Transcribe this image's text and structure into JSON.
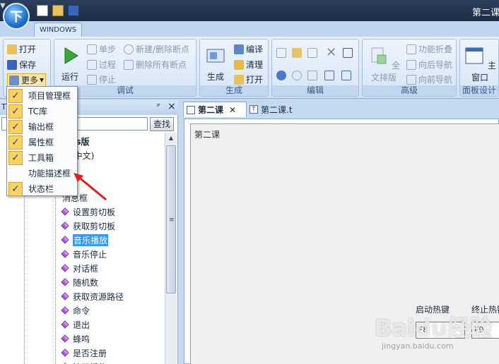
{
  "titlebar": {
    "app_logo": "下",
    "title": "第二课"
  },
  "ribbon": {
    "tab": "WINDOWS",
    "file": {
      "open": "打开",
      "save": "保存",
      "more": "更多"
    },
    "debug": {
      "label": "调试",
      "run": "运行",
      "step": "单步",
      "over": "过程",
      "stop": "停止",
      "new_bp": "新建/删除断点",
      "del_all_bp": "删除所有断点"
    },
    "build": {
      "label": "生成",
      "build": "生成",
      "compile": "编译",
      "clean": "清理",
      "open": "打开"
    },
    "edit": {
      "label": "编辑"
    },
    "advanced": {
      "label": "高级",
      "format": "全文排版",
      "fold": "功能折叠",
      "back": "向后导航",
      "forward": "向前导航"
    },
    "panel": {
      "label": "面板设计",
      "main_window": "主窗口"
    }
  },
  "dropdown": {
    "items": [
      {
        "label": "项目管理框",
        "checked": true
      },
      {
        "label": "TC库",
        "checked": true
      },
      {
        "label": "输出框",
        "checked": true
      },
      {
        "label": "属性框",
        "checked": true
      },
      {
        "label": "工具箱",
        "checked": true
      },
      {
        "label": "功能描述框",
        "checked": false
      },
      {
        "label": "状态栏",
        "checked": true
      }
    ]
  },
  "left_panel": {
    "header": "T",
    "pin": "ᴾ",
    "close": "×",
    "find_button": "查找",
    "tree": [
      {
        "label": "ows版",
        "bold": true,
        "partial": true
      },
      {
        "label": "文(中文)",
        "partial": true
      },
      {
        "label": "",
        "partial": true
      },
      {
        "label": "待",
        "partial": true
      },
      {
        "label": "消息框",
        "partial": true
      },
      {
        "label": "设置剪切板"
      },
      {
        "label": "获取剪切板"
      },
      {
        "label": "音乐播放",
        "selected": true
      },
      {
        "label": "音乐停止"
      },
      {
        "label": "对话框"
      },
      {
        "label": "随机数"
      },
      {
        "label": "获取资源路径"
      },
      {
        "label": "命令"
      },
      {
        "label": "退出"
      },
      {
        "label": "蜂鸣"
      },
      {
        "label": "是否注册"
      },
      {
        "label": "注册插件"
      }
    ]
  },
  "doc_tabs": [
    {
      "label": "第二课",
      "active": true
    },
    {
      "label": "第二课.t",
      "active": false
    }
  ],
  "editor": {
    "form_title": "第二课",
    "start_hotkey_label": "启动热键",
    "stop_hotkey_label": "终止热键",
    "start_hotkey_value": "F8",
    "stop_hotkey_value": "F9"
  },
  "watermark": {
    "text": "Baidu经验",
    "sub": "jingyan.baidu.com"
  },
  "colors": {
    "checked_bg": "#fbd25e",
    "selected_bg": "#3399ff",
    "arrow": "#e0201c"
  }
}
